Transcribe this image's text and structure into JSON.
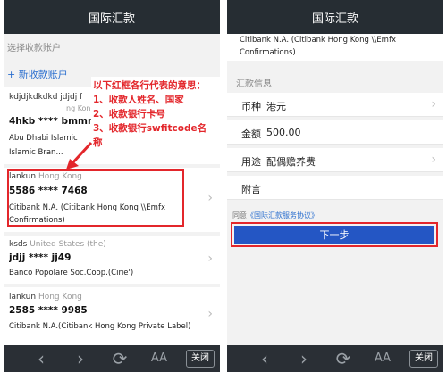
{
  "title": "国际汇款",
  "left": {
    "select_label": "选择收款账户",
    "add_account": "+ 新收款账户",
    "accounts": [
      {
        "name": "kdjdjkdkdkd jdjdj f",
        "country": "",
        "extra": "ng Kong",
        "number": "4hkb **** bmmn",
        "bank1": "Abu Dhabi Islamic",
        "bank2": "Islamic Bran..."
      },
      {
        "name": "lankun",
        "country": "Hong Kong",
        "number": "5586 **** 7468",
        "bank1": "Citibank N.A. (Citibank Hong Kong \\\\Emfx",
        "bank2": "Confirmations)"
      },
      {
        "name": "ksds",
        "country": "United States (the)",
        "number": "jdjj **** jj49",
        "bank1": "Banco Popolare Soc.Coop.(Cirie')"
      },
      {
        "name": "lankun",
        "country": "Hong Kong",
        "number": "2585 **** 9985",
        "bank1": "Citibank N.A.(Citibank Hong Kong Private Label)"
      }
    ],
    "annotation": {
      "title": "以下红框各行代表的意思：",
      "item1": "1、收款人姓名、国家",
      "item2": "2、收款银行卡号",
      "item3": "3、收款银行swfitcode名",
      "item3b": "称"
    }
  },
  "right": {
    "top_bank1": "Citibank N.A. (Citibank Hong Kong \\\\Emfx",
    "top_bank2": "Confirmations)",
    "section": "汇款信息",
    "currency_label": "币种",
    "currency_value": "港元",
    "amount_label": "金额",
    "amount_value": "500.00",
    "purpose_label": "用途",
    "purpose_value": "配偶赡养费",
    "remark_label": "附言",
    "agree_prefix": "同意",
    "agree_link": "《国际汇款服务协议》",
    "next": "下一步"
  },
  "bottom": {
    "back": "‹",
    "forward": "›",
    "refresh": "⟳",
    "font": "AA",
    "close": "关闭"
  },
  "colors": {
    "accent": "#2456c4",
    "annotation": "#e3262b",
    "titlebar": "#262d33"
  }
}
